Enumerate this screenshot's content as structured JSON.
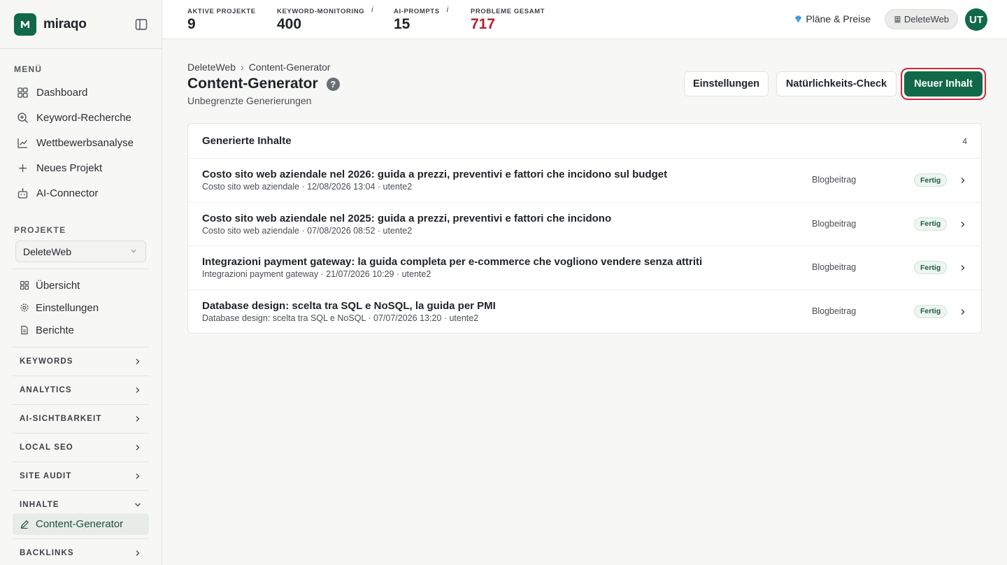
{
  "brand": {
    "name": "miraqo"
  },
  "sidebar": {
    "menu_label": "MENÜ",
    "menu": [
      {
        "label": "Dashboard",
        "icon": "grid-icon"
      },
      {
        "label": "Keyword-Recherche",
        "icon": "search-plus-icon"
      },
      {
        "label": "Wettbewerbsanalyse",
        "icon": "chart-line-icon"
      },
      {
        "label": "Neues Projekt",
        "icon": "plus-icon"
      },
      {
        "label": "AI-Connector",
        "icon": "robot-icon"
      }
    ],
    "projects_label": "PROJEKTE",
    "selected_project": "DeleteWeb",
    "project_menu": [
      {
        "label": "Übersicht",
        "icon": "grid-icon"
      },
      {
        "label": "Einstellungen",
        "icon": "gear-icon"
      },
      {
        "label": "Berichte",
        "icon": "document-icon"
      }
    ],
    "groups": [
      {
        "label": "KEYWORDS",
        "expanded": false
      },
      {
        "label": "ANALYTICS",
        "expanded": false
      },
      {
        "label": "AI-SICHTBARKEIT",
        "expanded": false
      },
      {
        "label": "LOCAL SEO",
        "expanded": false
      },
      {
        "label": "SITE AUDIT",
        "expanded": false
      },
      {
        "label": "INHALTE",
        "expanded": true
      },
      {
        "label": "BACKLINKS",
        "expanded": false
      }
    ],
    "active_item": {
      "label": "Content-Generator",
      "icon": "pencil-icon"
    }
  },
  "topbar": {
    "stats": [
      {
        "label": "AKTIVE PROJEKTE",
        "value": "9",
        "info": false
      },
      {
        "label": "KEYWORD-MONITORING",
        "value": "400",
        "info": true
      },
      {
        "label": "AI-PROMPTS",
        "value": "15",
        "info": true
      },
      {
        "label": "PROBLEME GESAMT",
        "value": "717",
        "info": false,
        "color": "#b3202e"
      }
    ],
    "info_glyph": "i",
    "plans_label": "Pläne & Preise",
    "workspace": "DeleteWeb",
    "avatar_initials": "UT"
  },
  "page": {
    "breadcrumb": [
      "DeleteWeb",
      "Content-Generator"
    ],
    "breadcrumb_sep": "›",
    "title": "Content-Generator",
    "help": "?",
    "subtitle": "Unbegrenzte Generierungen",
    "buttons": {
      "settings": "Einstellungen",
      "natural_check": "Natürlichkeits-Check",
      "new_content": "Neuer Inhalt"
    }
  },
  "content_list": {
    "title": "Generierte Inhalte",
    "count": "4",
    "items": [
      {
        "title": "Costo sito web aziendale nel 2026: guida a prezzi, preventivi e fattori che incidono sul budget",
        "meta": "Costo sito web aziendale · 12/08/2026 13:04 · utente2",
        "type": "Blogbeitrag",
        "status": "Fertig"
      },
      {
        "title": "Costo sito web aziendale nel 2025: guida a prezzi, preventivi e fattori che incidono",
        "meta": "Costo sito web aziendale · 07/08/2026 08:52 · utente2",
        "type": "Blogbeitrag",
        "status": "Fertig"
      },
      {
        "title": "Integrazioni payment gateway: la guida completa per e-commerce che vogliono vendere senza attriti",
        "meta": "Integrazioni payment gateway · 21/07/2026 10:29 · utente2",
        "type": "Blogbeitrag",
        "status": "Fertig"
      },
      {
        "title": "Database design: scelta tra SQL e NoSQL, la guida per PMI",
        "meta": "Database design: scelta tra SQL e NoSQL · 07/07/2026 13:20 · utente2",
        "type": "Blogbeitrag",
        "status": "Fertig"
      }
    ]
  },
  "colors": {
    "brand_green": "#12694a",
    "danger_red": "#b3202e",
    "highlight_outline": "#d12a3a"
  }
}
